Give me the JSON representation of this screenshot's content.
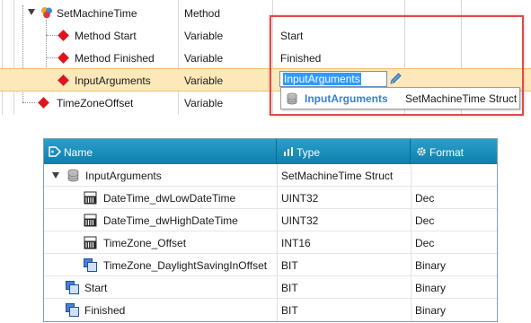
{
  "top_tree": {
    "rows": [
      {
        "name": "SetMachineTime",
        "type": "Method",
        "value": ""
      },
      {
        "name": "Method Start",
        "type": "Variable",
        "value": "Start"
      },
      {
        "name": "Method Finished",
        "type": "Variable",
        "value": "Finished"
      },
      {
        "name": "InputArguments",
        "type": "Variable",
        "value": ""
      },
      {
        "name": "TimeZoneOffset",
        "type": "Variable",
        "value": ""
      }
    ],
    "edit_value": "InputArguments",
    "dropdown": {
      "name": "InputArguments",
      "type": "SetMachineTime Struct"
    }
  },
  "bottom_table": {
    "headers": {
      "name": "Name",
      "type": "Type",
      "format": "Format"
    },
    "rows": [
      {
        "name": "InputArguments",
        "type": "SetMachineTime Struct",
        "format": "",
        "icon": "database-icon"
      },
      {
        "name": "DateTime_dwLowDateTime",
        "type": "UINT32",
        "format": "Dec",
        "icon": "numeric-icon"
      },
      {
        "name": "DateTime_dwHighDateTime",
        "type": "UINT32",
        "format": "Dec",
        "icon": "numeric-icon"
      },
      {
        "name": "TimeZone_Offset",
        "type": "INT16",
        "format": "Dec",
        "icon": "numeric-icon"
      },
      {
        "name": "TimeZone_DaylightSavingInOffset",
        "type": "BIT",
        "format": "Binary",
        "icon": "bit-icon"
      },
      {
        "name": "Start",
        "type": "BIT",
        "format": "Binary",
        "icon": "bit-icon"
      },
      {
        "name": "Finished",
        "type": "BIT",
        "format": "Binary",
        "icon": "bit-icon"
      }
    ]
  },
  "colors": {
    "accent_header": "#1a8fbf",
    "selection_row": "#fde8b9",
    "callout_border": "#e04a4a",
    "variable_diamond": "#e0141c",
    "dropdown_name": "#3a7fd5"
  }
}
